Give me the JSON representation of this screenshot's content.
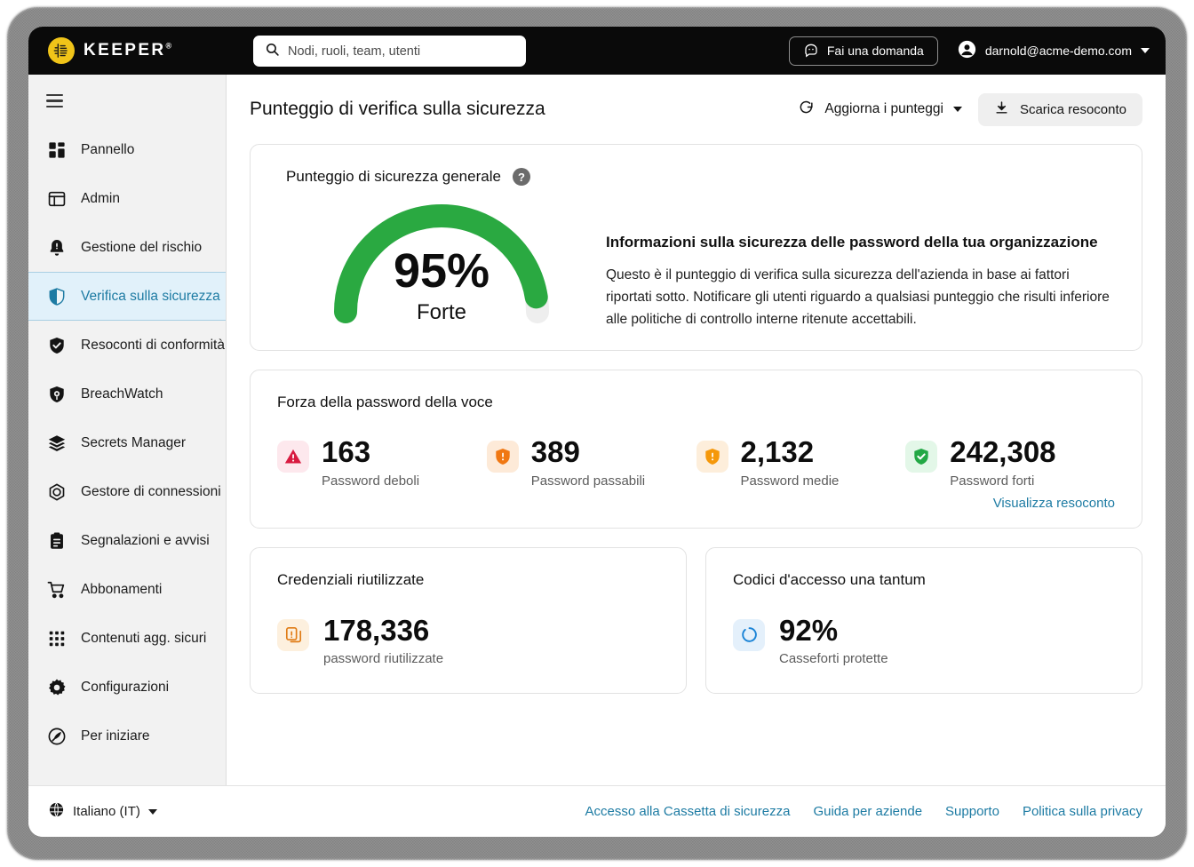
{
  "topbar": {
    "brand": "KEEPER",
    "brand_sup": "®",
    "search_placeholder": "Nodi, ruoli, team, utenti",
    "ask_label": "Fai una domanda",
    "account_email": "darnold@acme-demo.com"
  },
  "sidebar": {
    "items": [
      {
        "label": "Pannello",
        "icon": "dashboard-icon",
        "active": false
      },
      {
        "label": "Admin",
        "icon": "admin-panel-icon",
        "active": false
      },
      {
        "label": "Gestione del rischio",
        "icon": "bell-alert-icon",
        "active": false
      },
      {
        "label": "Verifica sulla sicurezza",
        "icon": "shield-half-icon",
        "active": true
      },
      {
        "label": "Resoconti di conformità",
        "icon": "shield-check-icon",
        "active": false
      },
      {
        "label": "BreachWatch",
        "icon": "shield-eye-icon",
        "active": false
      },
      {
        "label": "Secrets Manager",
        "icon": "layers-icon",
        "active": false
      },
      {
        "label": "Gestore di connessioni",
        "icon": "hex-circle-icon",
        "active": false
      },
      {
        "label": "Segnalazioni e avvisi",
        "icon": "clipboard-icon",
        "active": false
      },
      {
        "label": "Abbonamenti",
        "icon": "cart-icon",
        "active": false
      },
      {
        "label": "Contenuti agg. sicuri",
        "icon": "grid-dots-icon",
        "active": false
      },
      {
        "label": "Configurazioni",
        "icon": "gear-icon",
        "active": false
      },
      {
        "label": "Per iniziare",
        "icon": "rocket-icon",
        "active": false
      }
    ]
  },
  "page": {
    "title": "Punteggio di verifica sulla sicurezza",
    "refresh_label": "Aggiorna i punteggi",
    "download_label": "Scarica resoconto"
  },
  "score_card": {
    "title": "Punteggio di sicurezza generale",
    "help_glyph": "?",
    "gauge": {
      "percent": "95%",
      "percent_value": 95,
      "rating": "Forte",
      "fill_color": "#2aa941",
      "track_color": "#eeeeee"
    },
    "info_heading": "Informazioni sulla sicurezza delle password della tua organizzazione",
    "info_body": "Questo è il punteggio di verifica sulla sicurezza dell'azienda in base ai fattori riportati sotto. Notificare gli utenti riguardo a qualsiasi punteggio che risulti inferiore alle politiche di controllo interne ritenute accettabili."
  },
  "strength_card": {
    "title": "Forza della password della voce",
    "stats": [
      {
        "value": "163",
        "label": "Password deboli",
        "icon": "warning-triangle-icon",
        "icon_color": "#d81b40",
        "badge_bg": "#fde8ed"
      },
      {
        "value": "389",
        "label": "Password passabili",
        "icon": "shield-exclamation-icon",
        "icon_color": "#f07813",
        "badge_bg": "#fdead8"
      },
      {
        "value": "2,132",
        "label": "Password medie",
        "icon": "shield-exclamation-icon",
        "icon_color": "#f5980a",
        "badge_bg": "#fdeedb"
      },
      {
        "value": "242,308",
        "label": "Password forti",
        "icon": "shield-check-icon",
        "icon_color": "#23a845",
        "badge_bg": "#e3f7e8"
      }
    ],
    "view_report_label": "Visualizza resoconto"
  },
  "reused_card": {
    "title": "Credenziali riutilizzate",
    "value": "178,336",
    "label": "password riutilizzate",
    "icon": "copy-exclamation-icon",
    "icon_color": "#e07b15",
    "badge_bg": "#fdf0de"
  },
  "otp_card": {
    "title": "Codici d'accesso una tantum",
    "value": "92%",
    "label": "Casseforti protette",
    "icon": "progress-ring-icon",
    "icon_color": "#1a83d6",
    "badge_bg": "#e4f0fb"
  },
  "footer": {
    "language": "Italiano (IT)",
    "links": [
      "Accesso alla Cassetta di sicurezza",
      "Guida per aziende",
      "Supporto",
      "Politica sulla privacy"
    ]
  }
}
